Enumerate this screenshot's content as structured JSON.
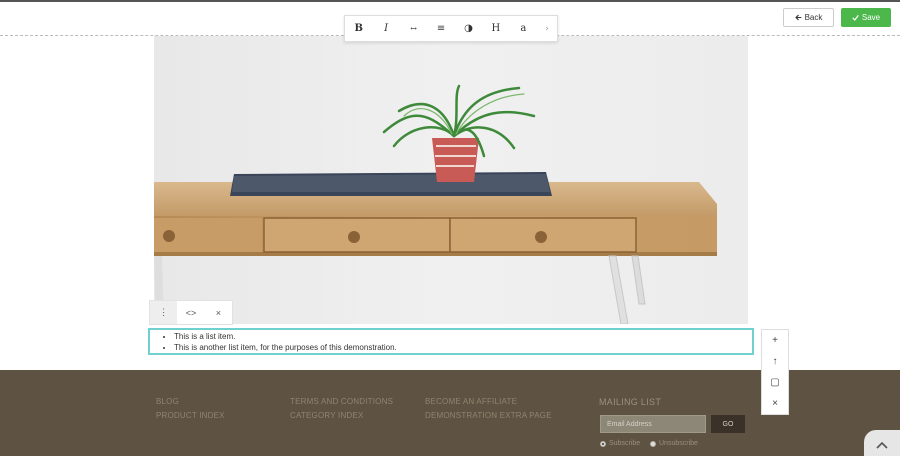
{
  "toolbar": {
    "buttons": [
      {
        "name": "bold",
        "label": "B"
      },
      {
        "name": "italic",
        "label": "I"
      },
      {
        "name": "strikethrough",
        "label": "↔"
      },
      {
        "name": "align",
        "label": "≡"
      },
      {
        "name": "color",
        "label": "◑"
      },
      {
        "name": "heading",
        "label": "H"
      },
      {
        "name": "font",
        "label": "a"
      }
    ],
    "more_label": "›"
  },
  "actions": {
    "back_label": "Back",
    "save_label": "Save"
  },
  "block_toolbar": {
    "menu": "⋮",
    "code": "<>",
    "close": "×"
  },
  "list": {
    "items": [
      "This is a list item.",
      "This is another list item, for the purposes of this demonstration."
    ]
  },
  "side_tools": {
    "add": "+",
    "up": "↑",
    "copy": "▢",
    "delete": "×"
  },
  "footer": {
    "col1": [
      "BLOG",
      "PRODUCT INDEX"
    ],
    "col2": [
      "TERMS AND CONDITIONS",
      "CATEGORY INDEX"
    ],
    "col3": [
      "BECOME AN AFFILIATE",
      "DEMONSTRATION EXTRA PAGE"
    ],
    "mailing": {
      "title": "MAILING LIST",
      "placeholder": "Email Address",
      "go_label": "GO",
      "subscribe_label": "Subscribe",
      "unsubscribe_label": "Unsubscribe"
    }
  },
  "colors": {
    "accent": "#4cb84c",
    "footer_bg": "#5e5342",
    "selection_border": "#6fd0cf"
  }
}
